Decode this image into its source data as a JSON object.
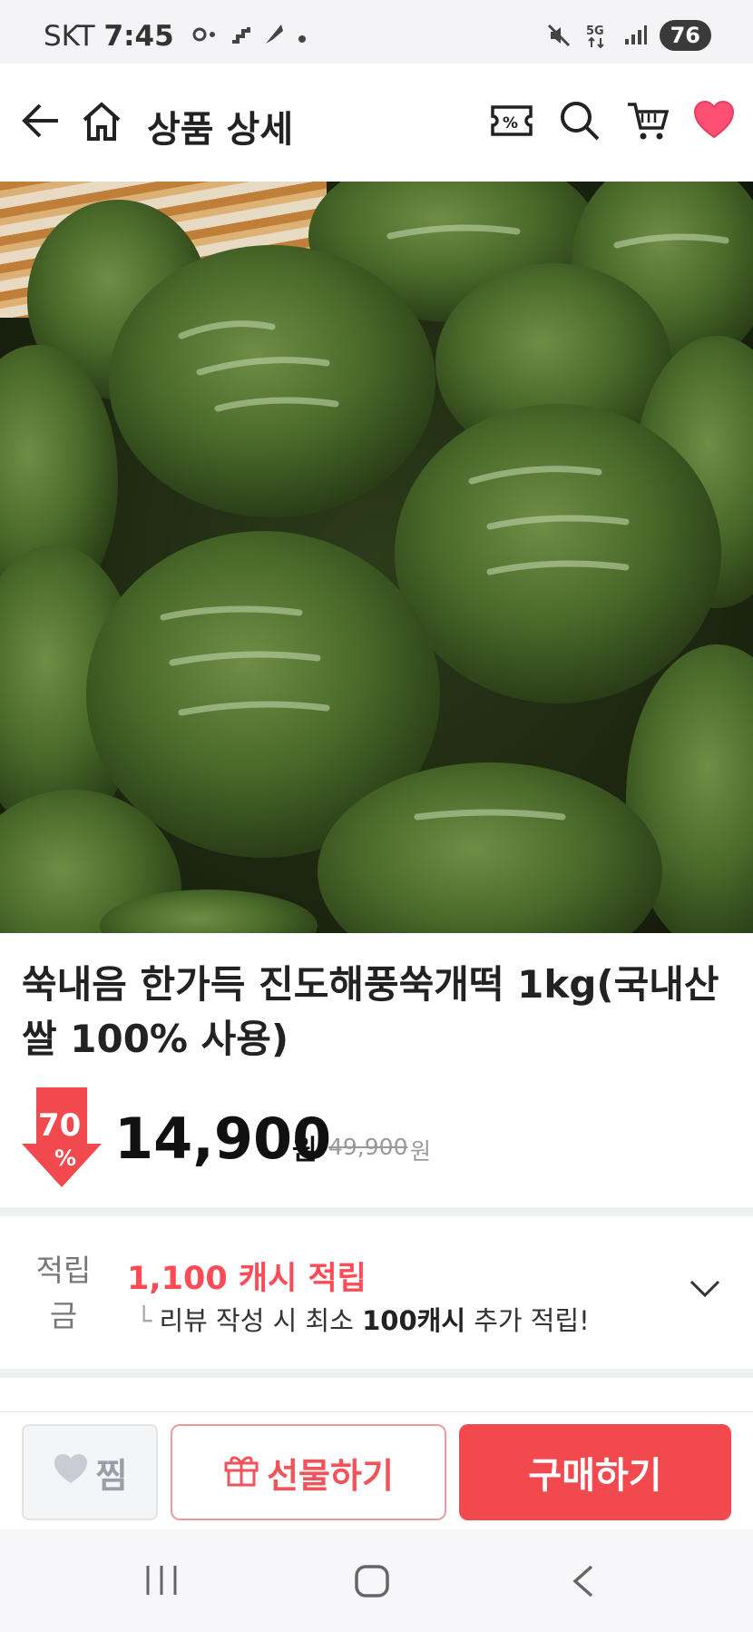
{
  "status_bar": {
    "carrier": "SKT",
    "time": "7:45",
    "network": "5G",
    "battery": "76"
  },
  "header": {
    "title": "상품 상세"
  },
  "product": {
    "title": "쑥내음 한가득 진도해풍쑥개떡 1kg(국내산 쌀 100% 사용)",
    "discount_rate": "70",
    "discount_symbol": "%",
    "price": "14,900",
    "price_unit": "원",
    "original_price": "49,900",
    "original_unit": "원"
  },
  "points": {
    "label": "적립금",
    "amount_text": "1,100 캐시 적립",
    "sub_lead": "└",
    "sub_before": "리뷰 작성 시 최소 ",
    "sub_bold": "100캐시",
    "sub_after": " 추가 적립!"
  },
  "actions": {
    "wish_label": "찜",
    "gift_label": "선물하기",
    "buy_label": "구매하기"
  },
  "colors": {
    "accent": "#f2494f",
    "points_red": "#ff4b55",
    "wish_heart": "#ff4f73"
  }
}
